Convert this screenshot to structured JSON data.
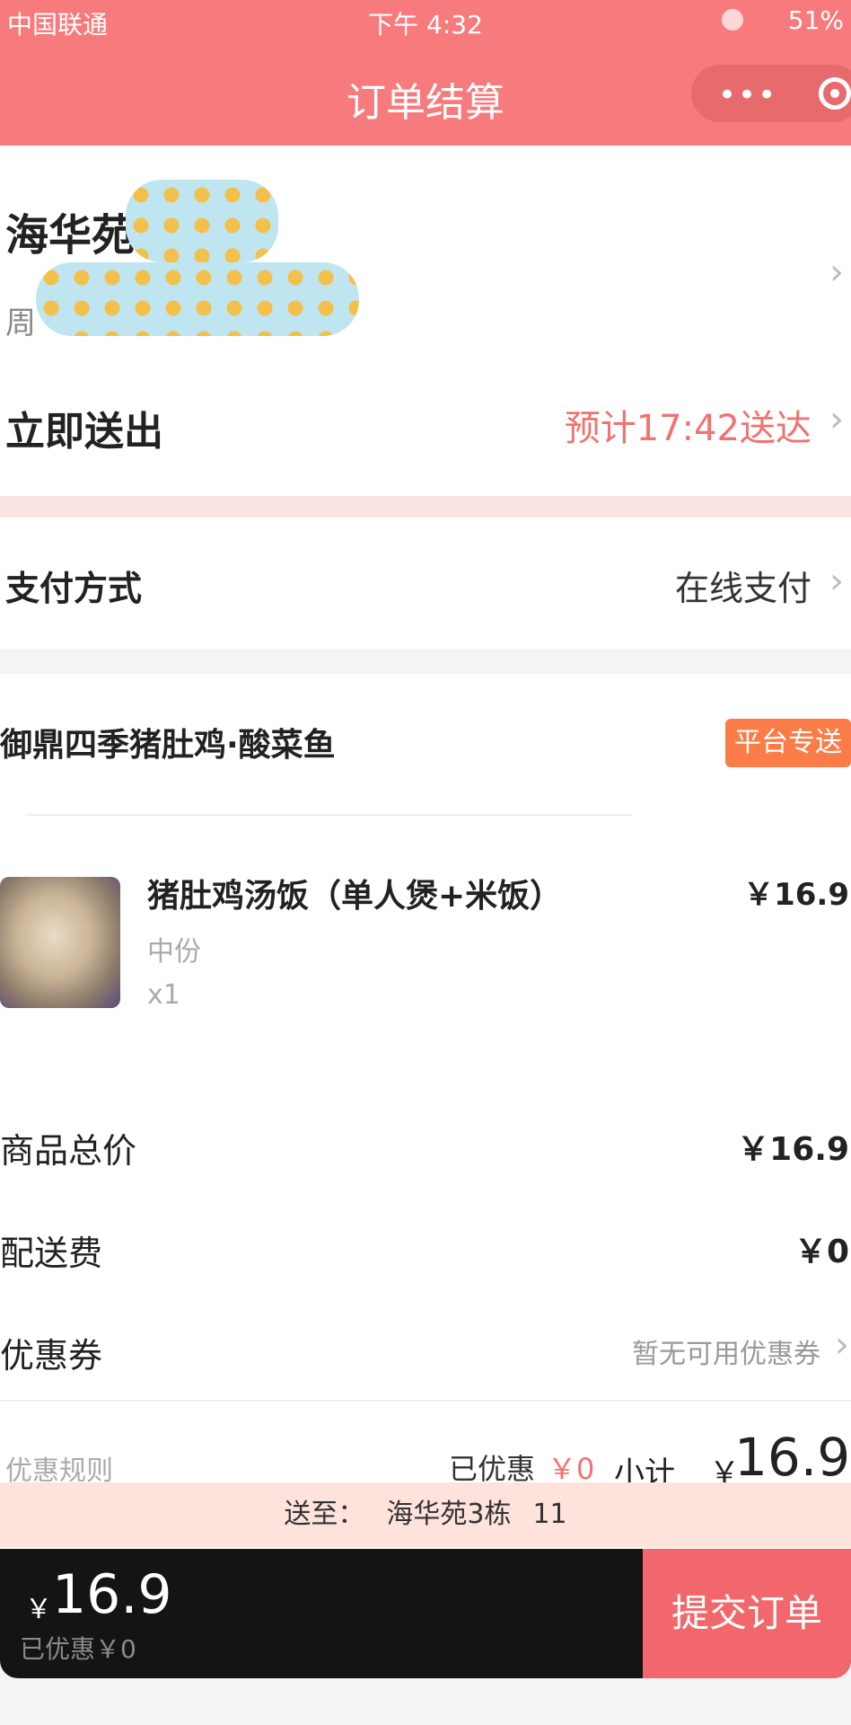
{
  "status_bar": {
    "carrier": "中国联通",
    "time": "下午 4:32",
    "battery": "51%"
  },
  "header": {
    "title": "订单结算"
  },
  "address": {
    "name": "海华苑",
    "detail": "周"
  },
  "delivery": {
    "label": "立即送出",
    "eta": "预计17:42送达"
  },
  "payment": {
    "label": "支付方式",
    "value": "在线支付"
  },
  "shop": {
    "name": "御鼎四季猪肚鸡·酸菜鱼",
    "badge": "平台专送"
  },
  "item": {
    "name": "猪肚鸡汤饭（单人煲+米饭）",
    "spec": "中份",
    "qty": "x1",
    "price": "￥16.9"
  },
  "summary": {
    "goods_label": "商品总价",
    "goods_value": "￥16.9",
    "delivery_fee_label": "配送费",
    "delivery_fee_value": "￥0",
    "coupon_label": "优惠券",
    "coupon_value": "暂无可用优惠券",
    "rules_label": "优惠规则",
    "discount_label": "已优惠",
    "discount_value": "￥0",
    "subtotal_label": "小计",
    "subtotal_currency": "￥",
    "subtotal_value": "16.9"
  },
  "ship_to": {
    "label": "送至：",
    "place": "海华苑3栋",
    "room": "11"
  },
  "checkout": {
    "currency": "￥",
    "total": "16.9",
    "discount": "已优惠￥0",
    "submit": "提交订单"
  },
  "colors": {
    "brand": "#f77a7d",
    "accent": "#f0736f",
    "badge": "#fb7c46",
    "checkout_bar": "#151414",
    "submit": "#f2676b"
  },
  "icons": [
    "more-icon",
    "target-icon",
    "moon-icon",
    "chevron-right-icon"
  ]
}
